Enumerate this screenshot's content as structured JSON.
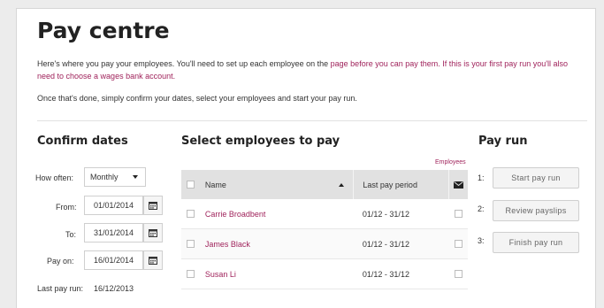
{
  "page": {
    "title": "Pay centre",
    "intro_a": "Here's where you pay your employees. You'll need to set up each employee on the ",
    "intro_link": "page before you can pay them.",
    "intro_b": " If this is your first pay run you'll also need to choose a wages bank account.",
    "intro2": "Once that's done, simply confirm your dates, select your employees and start your pay run."
  },
  "dates": {
    "heading": "Confirm dates",
    "how_often_label": "How often:",
    "how_often_value": "Monthly",
    "from_label": "From:",
    "from_value": "01/01/2014",
    "to_label": "To:",
    "to_value": "31/01/2014",
    "pay_on_label": "Pay on:",
    "pay_on_value": "16/01/2014",
    "last_pay_run_label": "Last pay run:",
    "last_pay_run_value": "16/12/2013",
    "calendar_icon": "calendar-icon"
  },
  "employees": {
    "heading": "Select employees to pay",
    "employees_link": "Employees",
    "columns": {
      "name": "Name",
      "period": "Last pay period"
    },
    "rows": [
      {
        "name": "Carrie Broadbent",
        "period": "01/12 - 31/12"
      },
      {
        "name": "James Black",
        "period": "01/12 - 31/12"
      },
      {
        "name": "Susan Li",
        "period": "01/12 - 31/12"
      }
    ]
  },
  "payrun": {
    "heading": "Pay run",
    "steps": [
      {
        "num": "1:",
        "label": "Start pay run"
      },
      {
        "num": "2:",
        "label": "Review payslips"
      },
      {
        "num": "3:",
        "label": "Finish pay run"
      }
    ]
  }
}
